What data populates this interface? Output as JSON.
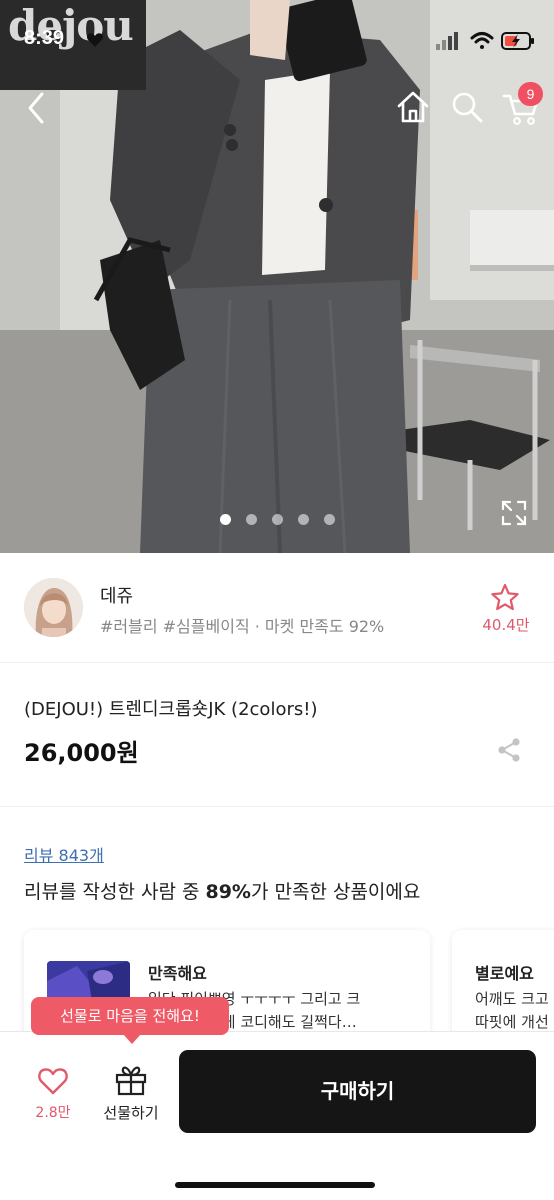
{
  "status_bar": {
    "time": "8:39"
  },
  "hero": {
    "brand_watermark": "dejou",
    "cart_count": "9",
    "slide_count": 5,
    "active_slide": 1
  },
  "seller": {
    "name": "데쥬",
    "tags": "#러블리 #심플베이직 · 마켓 만족도 92%",
    "favorite_count": "40.4만"
  },
  "product": {
    "title": "(DEJOU!) 트렌디크롭숏JK (2colors!)",
    "price": "26,000원"
  },
  "reviews": {
    "link_label": "리뷰 843개",
    "summary_prefix": "리뷰를 작성한 사람 중 ",
    "summary_percent": "89%",
    "summary_suffix": "가 만족한 상품이에요",
    "cards": [
      {
        "rating": "만족해요",
        "line1": "일단 핏이쁘영 ㅜㅜㅜㅜ 그리고 크",
        "line2": "롭이라 어떻게 코디해도 길쩍다…"
      },
      {
        "rating": "별로예요",
        "line1": "어깨도 크고",
        "line2": "따핏에 개선"
      }
    ]
  },
  "gift_tooltip": "선물로 마음을 전해요!",
  "bottom_bar": {
    "like_count": "2.8만",
    "gift_label": "선물하기",
    "buy_label": "구매하기"
  },
  "colors": {
    "accent_pink": "#ee5a66",
    "buy_button": "#151515",
    "link_blue": "#3e6fb3"
  }
}
